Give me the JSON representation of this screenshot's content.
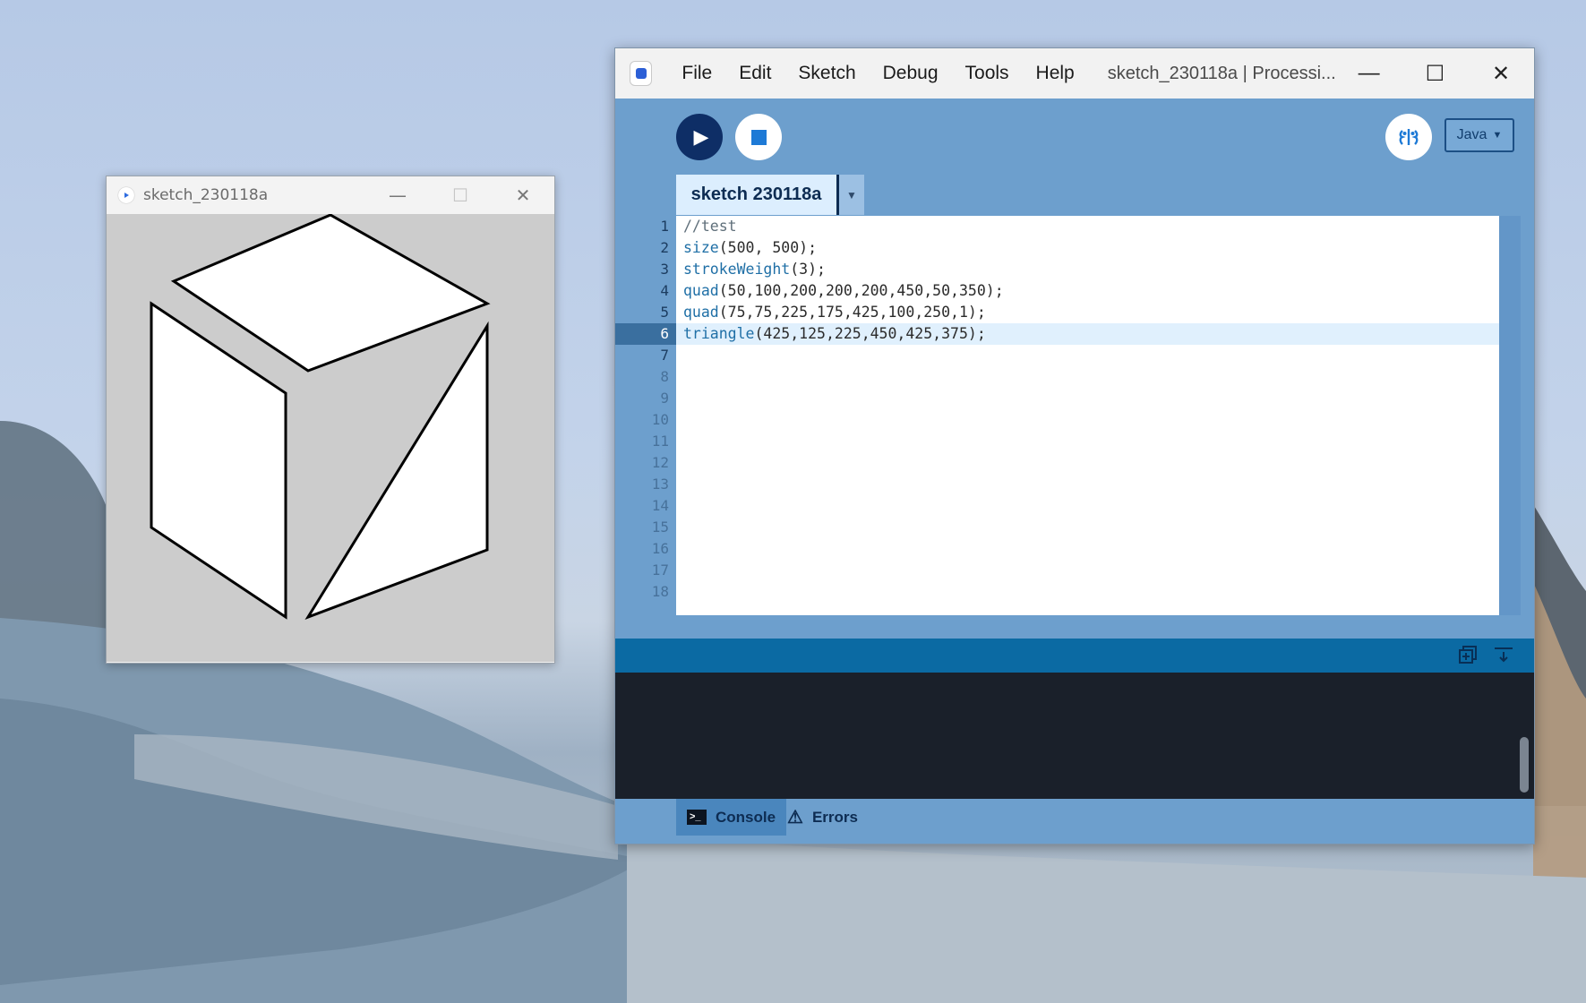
{
  "sketch_window": {
    "title": "sketch_230118a",
    "minimize": "—",
    "maximize": "☐",
    "close": "✕"
  },
  "ide": {
    "menu": [
      "File",
      "Edit",
      "Sketch",
      "Debug",
      "Tools",
      "Help"
    ],
    "window_title": "sketch_230118a | Processi...",
    "minimize": "—",
    "maximize": "☐",
    "close": "✕",
    "mode": "Java",
    "mode_arrow": "▼",
    "tab_label": "sketch 230118a",
    "tab_menu_arrow": "▼",
    "current_line": 6,
    "code_lines": [
      "//test",
      "size(500, 500);",
      "strokeWeight(3);",
      "quad(50,100,200,200,200,450,50,350);",
      "quad(75,75,225,175,425,100,250,1);",
      "triangle(425,125,225,450,425,375);",
      "",
      "",
      "",
      "",
      "",
      "",
      "",
      "",
      "",
      "",
      "",
      ""
    ],
    "line_numbers": [
      "1",
      "2",
      "3",
      "4",
      "5",
      "6",
      "7",
      "8",
      "9",
      "10",
      "11",
      "12",
      "13",
      "14",
      "15",
      "16",
      "17",
      "18"
    ],
    "footer_tabs": {
      "console": "Console",
      "errors": "Errors"
    },
    "icons": {
      "run": "run-icon",
      "stop": "stop-icon",
      "debug": "debug-icon",
      "console_copy": "copy-icon",
      "console_collapse": "collapse-icon",
      "console": "terminal-icon",
      "errors": "warning-icon"
    }
  },
  "colors": {
    "ide_background": "#6d9fcd",
    "run_button": "#0e2e66",
    "keyword": "#1f6fa6",
    "console_bar": "#0b6aa3",
    "console_background": "#1a202a",
    "sketch_canvas": "#cccccc"
  }
}
